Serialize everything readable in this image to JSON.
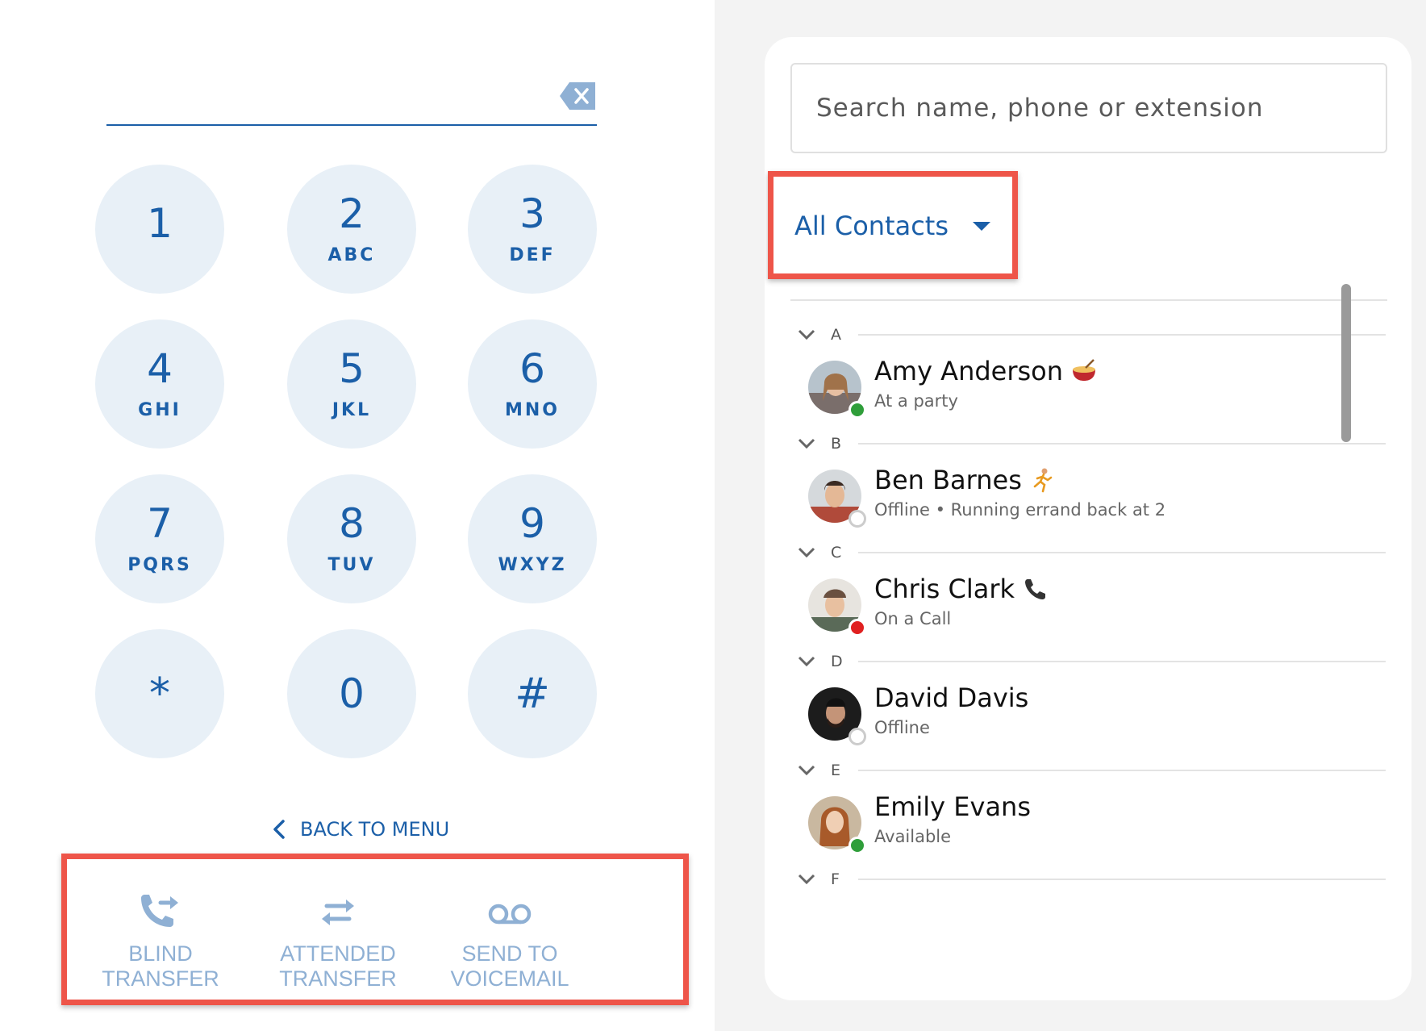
{
  "dialpad": {
    "input_value": "",
    "keys": [
      {
        "digit": "1",
        "letters": ""
      },
      {
        "digit": "2",
        "letters": "ABC"
      },
      {
        "digit": "3",
        "letters": "DEF"
      },
      {
        "digit": "4",
        "letters": "GHI"
      },
      {
        "digit": "5",
        "letters": "JKL"
      },
      {
        "digit": "6",
        "letters": "MNO"
      },
      {
        "digit": "7",
        "letters": "PQRS"
      },
      {
        "digit": "8",
        "letters": "TUV"
      },
      {
        "digit": "9",
        "letters": "WXYZ"
      },
      {
        "digit": "*",
        "letters": ""
      },
      {
        "digit": "0",
        "letters": ""
      },
      {
        "digit": "#",
        "letters": ""
      }
    ],
    "back_label": "BACK TO MENU",
    "actions": {
      "blind": {
        "line1": "BLIND",
        "line2": "TRANSFER"
      },
      "attended": {
        "line1": "ATTENDED",
        "line2": "TRANSFER"
      },
      "voicemail": {
        "line1": "SEND TO",
        "line2": "VOICEMAIL"
      }
    },
    "colors": {
      "accent": "#1b5fa8",
      "key_bg": "#e8f0f7",
      "action_text": "#8fb0d4",
      "highlight": "#ee5549"
    }
  },
  "contacts": {
    "search_placeholder": "Search name, phone or extension",
    "filter_label": "All Contacts",
    "sections": [
      "A",
      "B",
      "C",
      "D",
      "E",
      "F"
    ],
    "items": [
      {
        "name": "Amy Anderson",
        "status": "At a party",
        "presence": "available",
        "emoji": "party-icon"
      },
      {
        "name": "Ben Barnes",
        "status": "Offline • Running errand back at 2",
        "presence": "offline",
        "emoji": "runner-icon"
      },
      {
        "name": "Chris Clark",
        "status": "On a Call",
        "presence": "busy",
        "emoji": "phone-icon"
      },
      {
        "name": "David Davis",
        "status": "Offline",
        "presence": "offline",
        "emoji": ""
      },
      {
        "name": "Emily Evans",
        "status": "Available",
        "presence": "available",
        "emoji": ""
      }
    ],
    "presence_colors": {
      "available": "#2f9e3a",
      "busy": "#e02020",
      "offline": "#ffffff"
    }
  }
}
